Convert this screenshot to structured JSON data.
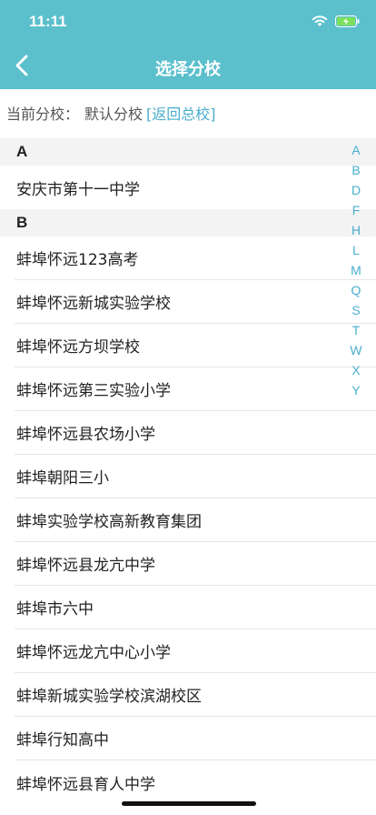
{
  "status_bar": {
    "time": "11:11"
  },
  "nav": {
    "title": "选择分校"
  },
  "current_branch": {
    "prefix": "当前分校：",
    "name": "默认分校",
    "return_link": "[返回总校]"
  },
  "sections": [
    {
      "letter": "A",
      "items": [
        "安庆市第十一中学"
      ]
    },
    {
      "letter": "B",
      "items": [
        "蚌埠怀远123高考",
        "蚌埠怀远新城实验学校",
        "蚌埠怀远方坝学校",
        "蚌埠怀远第三实验小学",
        "蚌埠怀远县农场小学",
        "蚌埠朝阳三小",
        "蚌埠实验学校高新教育集团",
        "蚌埠怀远县龙亢中学",
        "蚌埠市六中",
        "蚌埠怀远龙亢中心小学",
        "蚌埠新城实验学校滨湖校区",
        "蚌埠行知高中",
        "蚌埠怀远县育人中学"
      ]
    }
  ],
  "index_letters": [
    "A",
    "B",
    "D",
    "F",
    "H",
    "L",
    "M",
    "Q",
    "S",
    "T",
    "W",
    "X",
    "Y"
  ],
  "colors": {
    "header_bg": "#5bbfcc",
    "accent": "#4aaecc",
    "battery": "#7de05a"
  }
}
